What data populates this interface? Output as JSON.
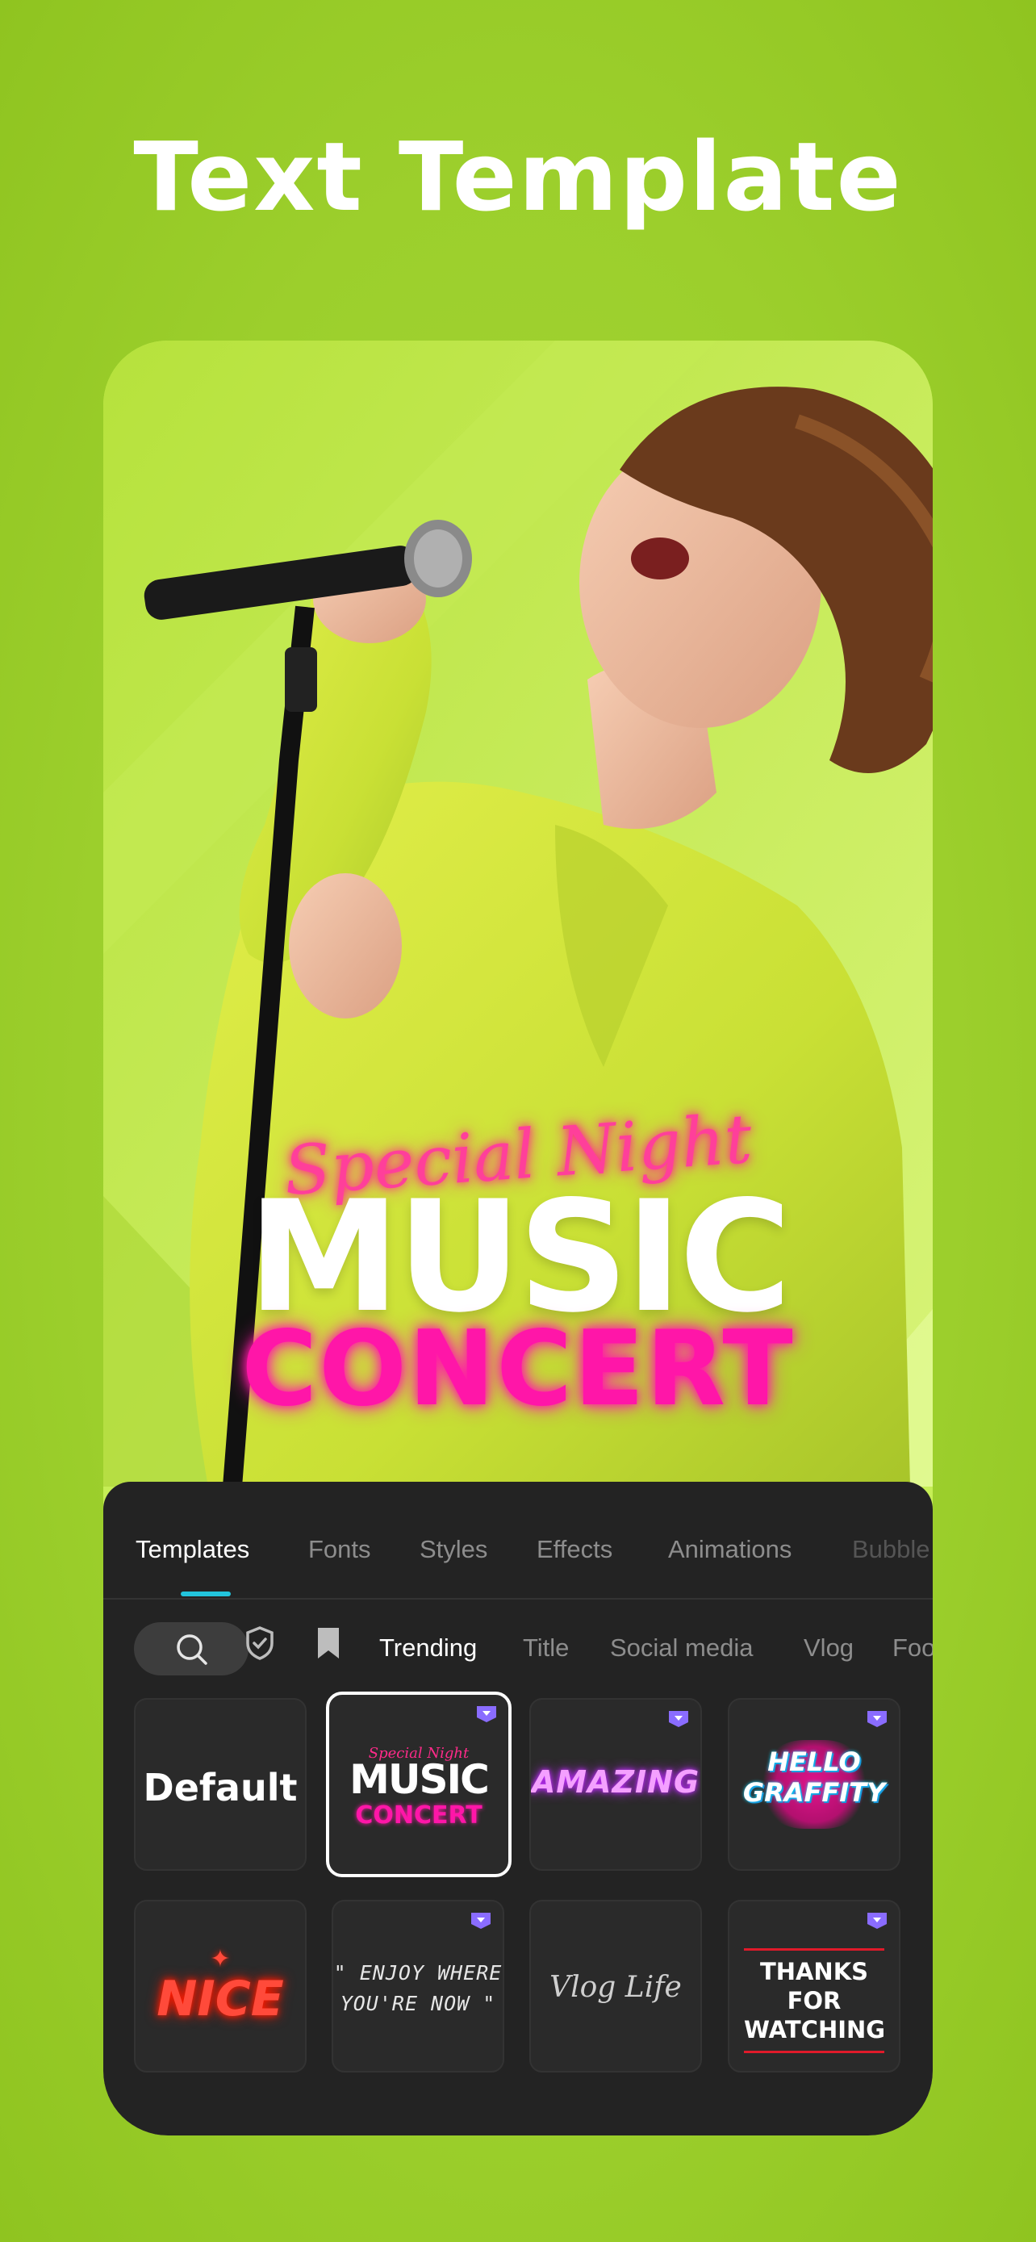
{
  "headline": "Text Template",
  "preview": {
    "overlay_script": "Special Night",
    "overlay_music": "MUSIC",
    "overlay_concert": "CONCERT"
  },
  "tabs": [
    {
      "label": "Templates",
      "active": true
    },
    {
      "label": "Fonts"
    },
    {
      "label": "Styles"
    },
    {
      "label": "Effects"
    },
    {
      "label": "Animations"
    },
    {
      "label": "Bubble"
    }
  ],
  "filters": {
    "chips": [
      {
        "label": "Trending",
        "active": true
      },
      {
        "label": "Title"
      },
      {
        "label": "Social media"
      },
      {
        "label": "Vlog"
      },
      {
        "label": "Foo"
      }
    ]
  },
  "tiles": [
    {
      "name": "default",
      "text": "Default",
      "premium": false
    },
    {
      "name": "music-concert",
      "script": "Special Night",
      "music": "MUSIC",
      "concert": "CONCERT",
      "premium": true,
      "selected": true
    },
    {
      "name": "amazing",
      "text": "AMAZING",
      "premium": true
    },
    {
      "name": "hello-graffiti",
      "line1": "HELLO",
      "line2": "GRAFFITY",
      "premium": true
    },
    {
      "name": "nice",
      "text": "NICE",
      "premium": false
    },
    {
      "name": "enjoy-where",
      "line1": "\" ENJOY WHERE",
      "line2": "YOU'RE NOW \"",
      "premium": true
    },
    {
      "name": "vlog-life",
      "text": "Vlog Life",
      "premium": false
    },
    {
      "name": "thanks-for-watching",
      "line1": "THANKS FOR",
      "line2": "WATCHING",
      "premium": true
    }
  ],
  "colors": {
    "background": "#9ccf2c",
    "panel": "#232323",
    "accent": "#22c4dc",
    "premium_badge": "#8a6cff",
    "neon_pink": "#ff16a8"
  }
}
